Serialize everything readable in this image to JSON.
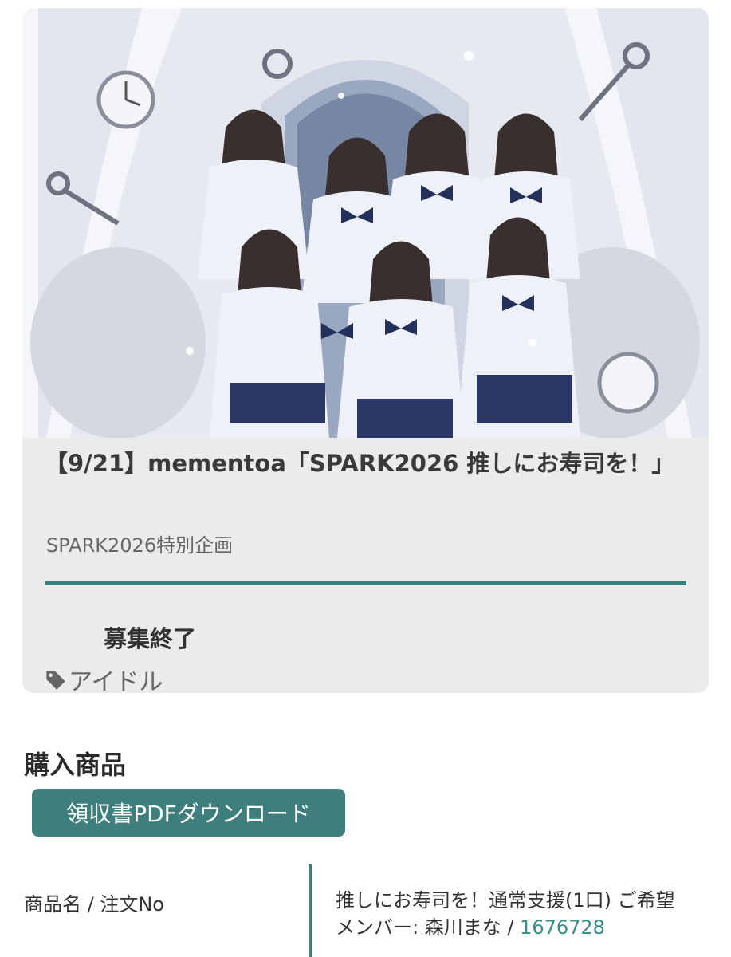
{
  "project": {
    "title": "【9/21】mementoa「SPARK2026 推しにお寿司を！」",
    "subtitle": "SPARK2026特別企画",
    "progress_fraction": 1.0,
    "status": "募集終了",
    "tag": "アイドル",
    "image_alt": "mementoa group photo"
  },
  "purchase": {
    "heading": "購入商品",
    "pdf_button_label": "領収書PDFダウンロード",
    "row_label": "商品名 / 注文No",
    "product_text": "推しにお寿司を！通常支援(1口) ご希望メンバー: 森川まな / ",
    "order_no": "1676728"
  },
  "colors": {
    "accent": "#3e7f7d",
    "link": "#3a8c89",
    "card_bg": "#ebebeb"
  },
  "icons": {
    "tag": "tag-icon"
  }
}
